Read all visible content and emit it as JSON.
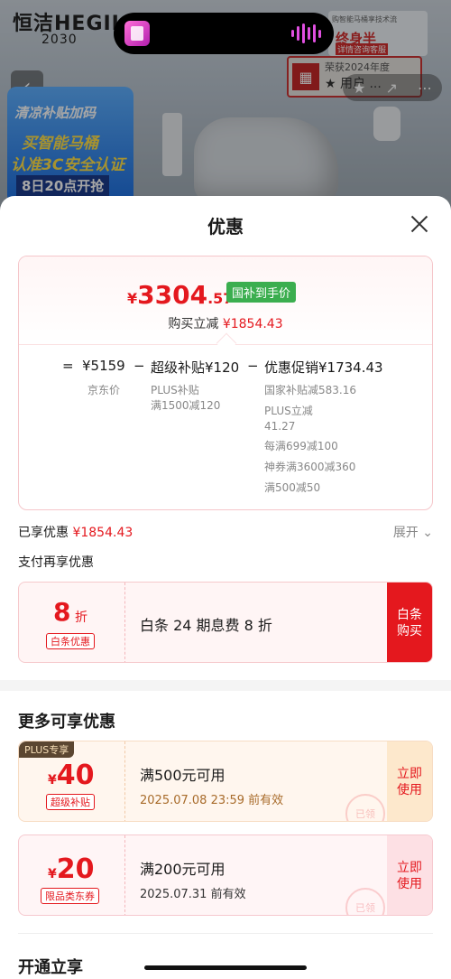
{
  "background": {
    "brand_logo": "恒洁HEGII",
    "brand_sub": "2030",
    "promo": {
      "line1": "清凉补贴加码",
      "line2": "买智能马桶",
      "line3": "认准3C安全认证",
      "line4": "8日20点开抢"
    },
    "ad_text": "荣获2024年度",
    "ad_text2": "★ 用户 ...",
    "announce_small": "购智能马桶享技术流",
    "announce_big": "终身半",
    "announce_btn": "详情咨询客服"
  },
  "sheet": {
    "title": "优惠",
    "price_card": {
      "currency": "¥",
      "price_int": "3304",
      "price_dec": ".57",
      "tag": "国补到手价",
      "buy_label": "购买立减",
      "buy_amount": "¥1854.43",
      "eq": "=",
      "base_price": "¥5159",
      "base_label": "京东价",
      "minus1": "−",
      "super_label": "超级补贴¥120",
      "super_sub1": "PLUS补贴",
      "super_sub2": "满1500减120",
      "minus2": "−",
      "promo_label": "优惠促销¥1734.43",
      "promo_details": [
        "国家补贴减583.16",
        "PLUS立减",
        "41.27",
        "每满699减100",
        "神券满3600减360",
        "满500减50"
      ]
    },
    "enjoyed_label": "已享优惠",
    "enjoyed_amount": "¥1854.43",
    "expand_label": "展开",
    "pay_title": "支付再享优惠",
    "pay_card": {
      "big": "8",
      "small": "折",
      "pill": "白条优惠",
      "desc": "白条 24 期息费 8 折",
      "btn_line1": "白条",
      "btn_line2": "购买"
    },
    "more_title": "更多可享优惠",
    "coupons": [
      {
        "tag": "PLUS专享",
        "currency": "¥",
        "amount": "40",
        "pill": "超级补贴",
        "title": "满500元可用",
        "expire": "2025.07.08 23:59 前有效",
        "use1": "立即",
        "use2": "使用",
        "stamp": "已领"
      },
      {
        "currency": "¥",
        "amount": "20",
        "pill": "限品类东券",
        "title": "满200元可用",
        "expire": "2025.07.31 前有效",
        "use1": "立即",
        "use2": "使用",
        "stamp": "已领"
      }
    ],
    "open_title": "开通立享"
  },
  "colors": {
    "accent_red": "#e4181e",
    "green_tag": "#3bae4f",
    "plus_brown": "#5b4631"
  }
}
